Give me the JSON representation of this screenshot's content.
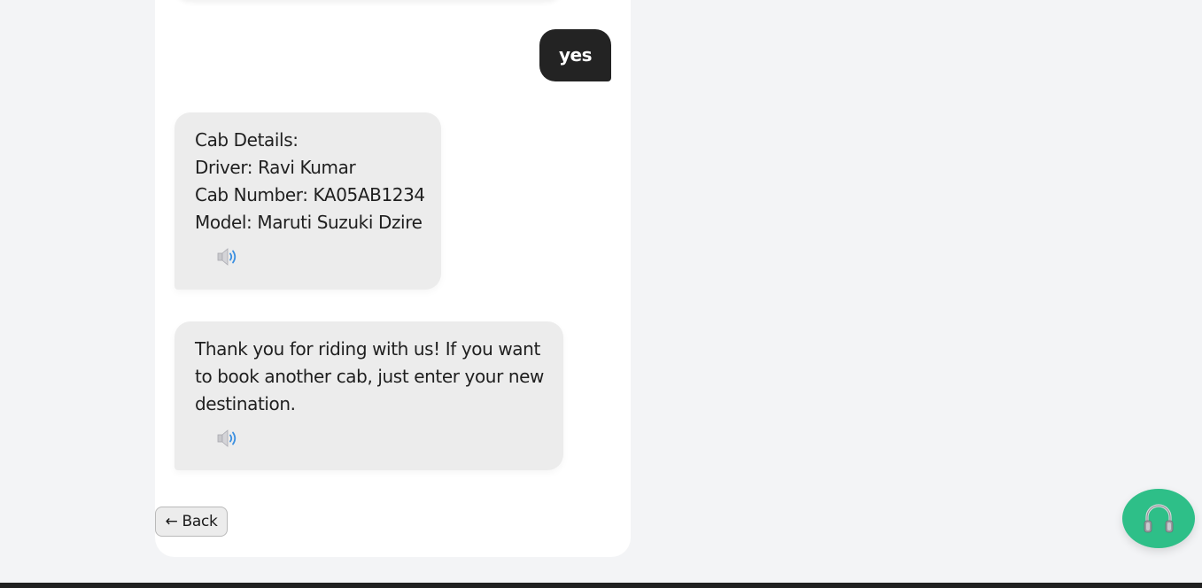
{
  "chat": {
    "user_message": "yes",
    "cab_details": {
      "lines": [
        "Cab Details:",
        "Driver: Ravi Kumar",
        "Cab Number: KA05AB1234",
        "Model: Maruti Suzuki Dzire"
      ],
      "speaker_icon": "speaker-icon"
    },
    "closing_message": {
      "text": "Thank you for riding with us! If you want to book another cab, just enter your new destination.",
      "speaker_icon": "speaker-icon"
    }
  },
  "back_button": {
    "label": "← Back"
  },
  "support_button": {
    "icon": "headphones-icon"
  },
  "colors": {
    "page_background": "#f3f4f6",
    "chat_panel": "#ffffff",
    "user_bubble": "#232323",
    "bot_bubble": "#ececec",
    "support_button": "#2ebf88"
  }
}
